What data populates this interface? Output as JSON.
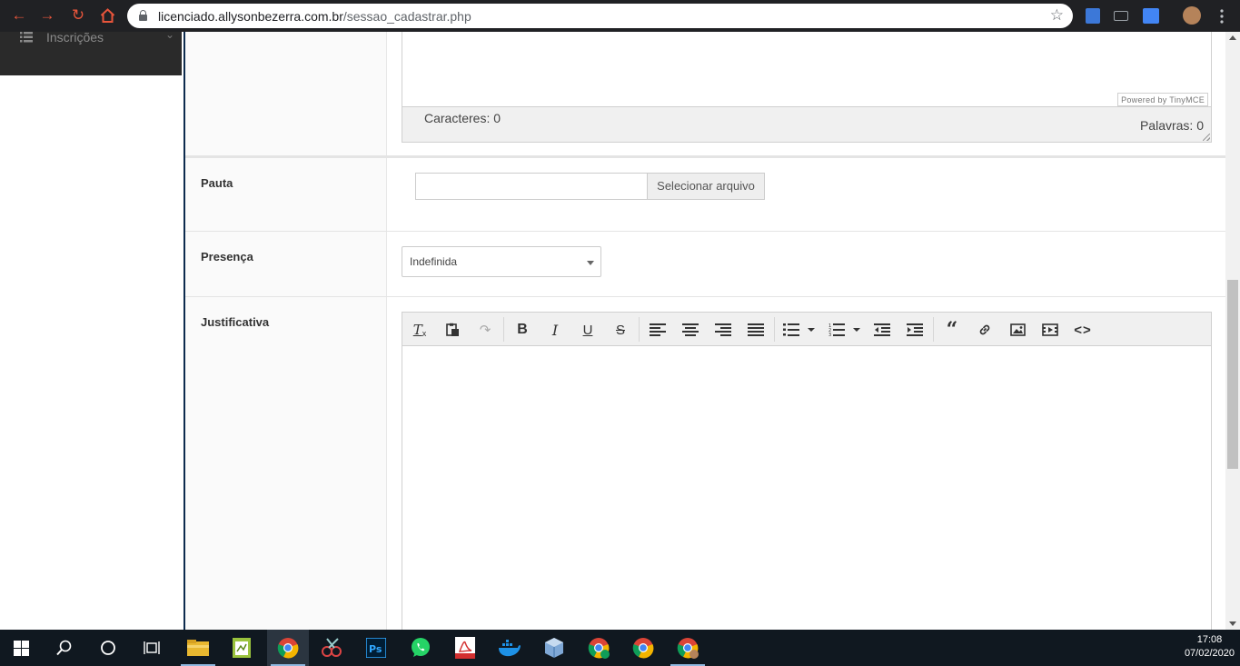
{
  "browser": {
    "url_host": "licenciado.allysonbezerra.com.br",
    "url_path": "/sessao_cadastrar.php"
  },
  "sidebar": {
    "item_label": "Inscrições"
  },
  "editor_top": {
    "powered_by": "Powered by TinyMCE",
    "chars_label": "Caracteres: 0",
    "words_label": "Palavras: 0"
  },
  "form": {
    "pauta_label": "Pauta",
    "file_button_label": "Selecionar arquivo",
    "presenca_label": "Presença",
    "presenca_value": "Indefinida",
    "justificativa_label": "Justificativa"
  },
  "taskbar": {
    "time": "17:08",
    "date": "07/02/2020",
    "accent_color": "#8fb8e0"
  }
}
